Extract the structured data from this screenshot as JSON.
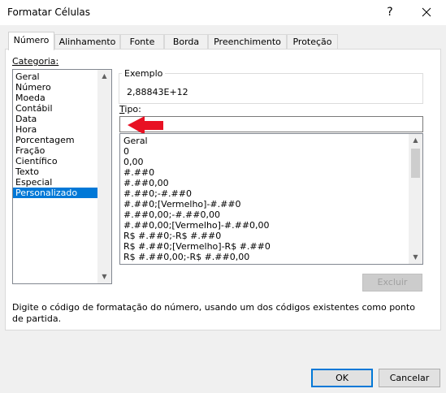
{
  "window": {
    "title": "Formatar Células"
  },
  "tabs": [
    "Número",
    "Alinhamento",
    "Fonte",
    "Borda",
    "Preenchimento",
    "Proteção"
  ],
  "category": {
    "label": "Categoria:",
    "items": [
      "Geral",
      "Número",
      "Moeda",
      "Contábil",
      "Data",
      "Hora",
      "Porcentagem",
      "Fração",
      "Científico",
      "Texto",
      "Especial",
      "Personalizado"
    ],
    "selected_index": 11
  },
  "sample": {
    "label": "Exemplo",
    "value": "2,88843E+12"
  },
  "type": {
    "label": "Tipo:",
    "value": "",
    "formats": [
      "Geral",
      "0",
      "0,00",
      "#.##0",
      "#.##0,00",
      "#.##0;-#.##0",
      "#.##0;[Vermelho]-#.##0",
      "#.##0,00;-#.##0,00",
      "#.##0,00;[Vermelho]-#.##0,00",
      "R$ #.##0;-R$ #.##0",
      "R$ #.##0;[Vermelho]-R$ #.##0",
      "R$ #.##0,00;-R$ #.##0,00"
    ]
  },
  "buttons": {
    "delete": "Excluir",
    "ok": "OK",
    "cancel": "Cancelar"
  },
  "description": "Digite o código de formatação do número, usando um dos códigos existentes como ponto de partida.",
  "colors": {
    "accent": "#0078d7",
    "arrow": "#e81123"
  }
}
